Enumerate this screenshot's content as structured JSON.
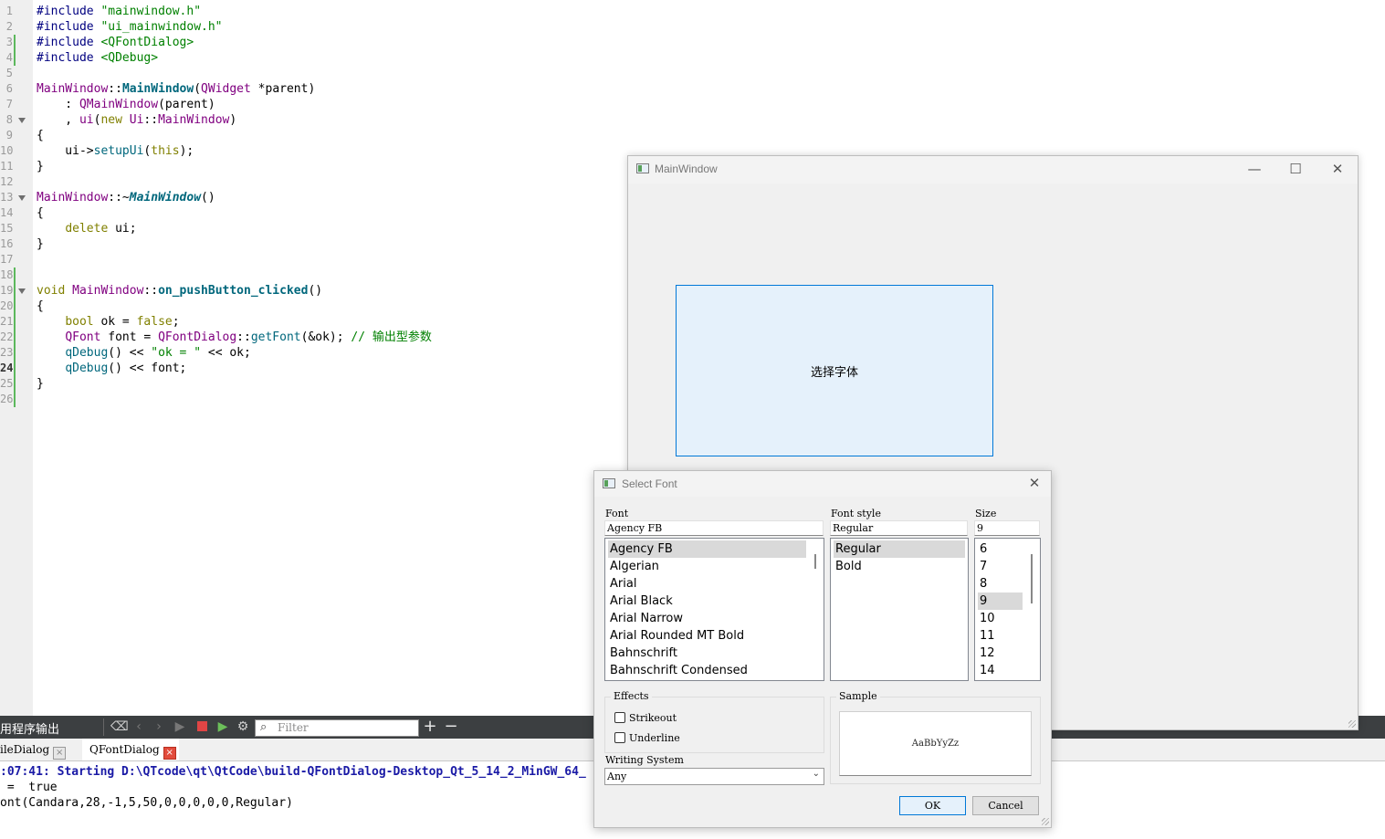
{
  "editor": {
    "line_numbers": [
      "1",
      "2",
      "3",
      "4",
      "5",
      "6",
      "7",
      "8",
      "9",
      "10",
      "11",
      "12",
      "13",
      "14",
      "15",
      "16",
      "17",
      "18",
      "19",
      "20",
      "21",
      "22",
      "23",
      "24",
      "25",
      "26"
    ],
    "lines": [
      [
        {
          "t": "#include ",
          "c": "pp"
        },
        {
          "t": "\"mainwindow.h\"",
          "c": "str"
        }
      ],
      [
        {
          "t": "#include ",
          "c": "pp"
        },
        {
          "t": "\"ui_mainwindow.h\"",
          "c": "str"
        }
      ],
      [
        {
          "t": "#include ",
          "c": "pp"
        },
        {
          "t": "<QFontDialog>",
          "c": "str"
        }
      ],
      [
        {
          "t": "#include ",
          "c": "pp"
        },
        {
          "t": "<QDebug>",
          "c": "str"
        }
      ],
      [],
      [
        {
          "t": "MainWindow",
          "c": "ty"
        },
        {
          "t": "::",
          "c": ""
        },
        {
          "t": "MainWindow",
          "c": "fnb"
        },
        {
          "t": "(",
          "c": ""
        },
        {
          "t": "QWidget",
          "c": "ty"
        },
        {
          "t": " *parent)",
          "c": ""
        }
      ],
      [
        {
          "t": "    : ",
          "c": ""
        },
        {
          "t": "QMainWindow",
          "c": "ty"
        },
        {
          "t": "(parent)",
          "c": ""
        }
      ],
      [
        {
          "t": "    , ",
          "c": ""
        },
        {
          "t": "ui",
          "c": "ty"
        },
        {
          "t": "(",
          "c": ""
        },
        {
          "t": "new",
          "c": "kw"
        },
        {
          "t": " ",
          "c": ""
        },
        {
          "t": "Ui",
          "c": "ty"
        },
        {
          "t": "::",
          "c": ""
        },
        {
          "t": "MainWindow",
          "c": "ty"
        },
        {
          "t": ")",
          "c": ""
        }
      ],
      [
        {
          "t": "{",
          "c": ""
        }
      ],
      [
        {
          "t": "    ui->",
          "c": ""
        },
        {
          "t": "setupUi",
          "c": "fn"
        },
        {
          "t": "(",
          "c": ""
        },
        {
          "t": "this",
          "c": "kw"
        },
        {
          "t": ");",
          "c": ""
        }
      ],
      [
        {
          "t": "}",
          "c": ""
        }
      ],
      [],
      [
        {
          "t": "MainWindow",
          "c": "ty"
        },
        {
          "t": "::~",
          "c": ""
        },
        {
          "t": "MainWindow",
          "c": "fni"
        },
        {
          "t": "()",
          "c": ""
        }
      ],
      [
        {
          "t": "{",
          "c": ""
        }
      ],
      [
        {
          "t": "    ",
          "c": ""
        },
        {
          "t": "delete",
          "c": "kw"
        },
        {
          "t": " ui;",
          "c": ""
        }
      ],
      [
        {
          "t": "}",
          "c": ""
        }
      ],
      [],
      [],
      [
        {
          "t": "void",
          "c": "kw"
        },
        {
          "t": " ",
          "c": ""
        },
        {
          "t": "MainWindow",
          "c": "ty"
        },
        {
          "t": "::",
          "c": ""
        },
        {
          "t": "on_pushButton_clicked",
          "c": "fnb"
        },
        {
          "t": "()",
          "c": ""
        }
      ],
      [
        {
          "t": "{",
          "c": ""
        }
      ],
      [
        {
          "t": "    ",
          "c": ""
        },
        {
          "t": "bool",
          "c": "kw"
        },
        {
          "t": " ok = ",
          "c": ""
        },
        {
          "t": "false",
          "c": "kw"
        },
        {
          "t": ";",
          "c": ""
        }
      ],
      [
        {
          "t": "    ",
          "c": ""
        },
        {
          "t": "QFont",
          "c": "ty"
        },
        {
          "t": " font = ",
          "c": ""
        },
        {
          "t": "QFontDialog",
          "c": "ty"
        },
        {
          "t": "::",
          "c": ""
        },
        {
          "t": "getFont",
          "c": "fn"
        },
        {
          "t": "(&ok); ",
          "c": ""
        },
        {
          "t": "// 输出型参数",
          "c": "cm"
        }
      ],
      [
        {
          "t": "    ",
          "c": ""
        },
        {
          "t": "qDebug",
          "c": "fn"
        },
        {
          "t": "() << ",
          "c": ""
        },
        {
          "t": "\"ok = \"",
          "c": "str"
        },
        {
          "t": " << ok;",
          "c": ""
        }
      ],
      [
        {
          "t": "    ",
          "c": ""
        },
        {
          "t": "qDebug",
          "c": "fn"
        },
        {
          "t": "() << font;",
          "c": ""
        }
      ],
      [
        {
          "t": "}",
          "c": ""
        }
      ],
      []
    ]
  },
  "output": {
    "title": "用程序输出",
    "filter_placeholder": "Filter",
    "tabs": [
      {
        "label": "ileDialog"
      },
      {
        "label": "QFontDialog"
      }
    ],
    "lines": [
      ":07:41: Starting D:\\QTcode\\qt\\QtCode\\build-QFontDialog-Desktop_Qt_5_14_2_MinGW_64_",
      " =  true",
      "ont(Candara,28,-1,5,50,0,0,0,0,0,Regular)"
    ]
  },
  "main_window": {
    "title": "MainWindow",
    "button_label": "选择字体"
  },
  "font_dialog": {
    "title": "Select Font",
    "font_label": "Font",
    "font_value": "Agency FB",
    "fonts": [
      "Agency FB",
      "Algerian",
      "Arial",
      "Arial Black",
      "Arial Narrow",
      "Arial Rounded MT Bold",
      "Bahnschrift",
      "Bahnschrift Condensed"
    ],
    "style_label": "Font style",
    "style_value": "Regular",
    "styles": [
      "Regular",
      "Bold"
    ],
    "size_label": "Size",
    "size_value": "9",
    "sizes": [
      "6",
      "7",
      "8",
      "9",
      "10",
      "11",
      "12",
      "14"
    ],
    "effects_label": "Effects",
    "strikeout_label": "Strikeout",
    "underline_label": "Underline",
    "sample_label": "Sample",
    "sample_text": "AaBbYyZz",
    "writing_system_label": "Writing System",
    "writing_system_value": "Any",
    "ok_label": "OK",
    "cancel_label": "Cancel"
  }
}
